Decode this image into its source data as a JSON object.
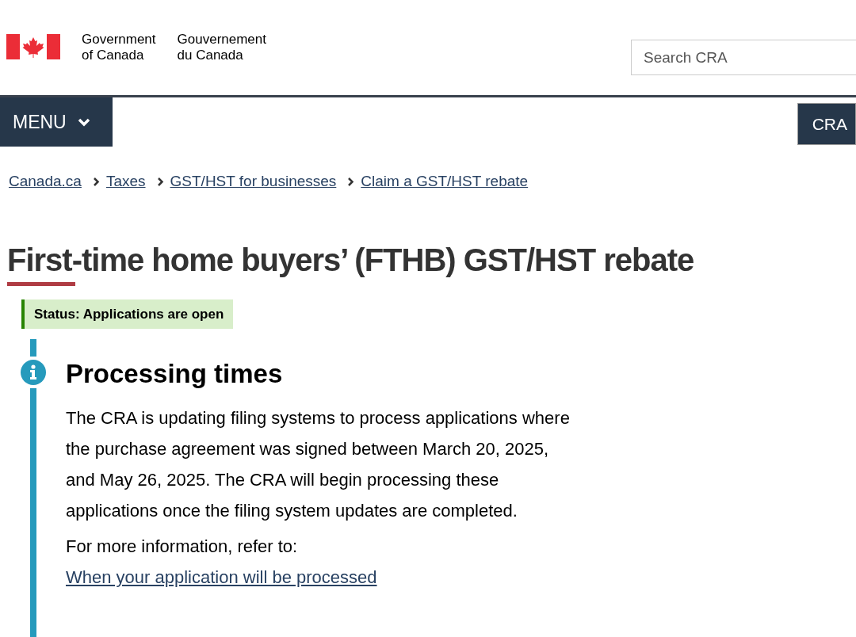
{
  "header": {
    "name_en": [
      "Government",
      "of Canada"
    ],
    "name_fr": [
      "Gouvernement",
      "du Canada"
    ],
    "search": {
      "placeholder": "Search CRA"
    }
  },
  "nav": {
    "menu": "MENU",
    "site_button": "CRA"
  },
  "breadcrumbs": [
    "Canada.ca",
    "Taxes",
    "GST/HST for businesses",
    "Claim a GST/HST rebate"
  ],
  "title": "First-time home buyers’ (FTHB) GST/HST rebate",
  "status": "Status: Applications are open",
  "alert": {
    "kind": "info",
    "heading": "Processing times",
    "paragraphs": [
      "The CRA is updating filing systems to process applications where the purchase agreement was signed between March 20, 2025, and May 26, 2025. The CRA will begin processing these applications once the filing system updates are completed."
    ],
    "more": {
      "text": "For more information, refer to:",
      "link": "When your application will be processed"
    }
  }
}
